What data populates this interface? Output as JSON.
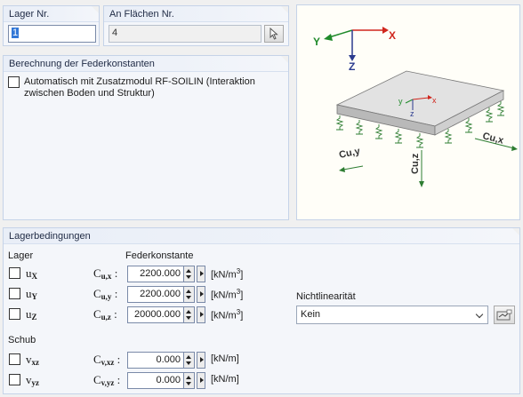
{
  "lager_panel": {
    "title": "Lager Nr.",
    "value": "1"
  },
  "flaechen_panel": {
    "title": "An Flächen Nr.",
    "value": "4"
  },
  "federkonstanten_panel": {
    "title": "Berechnung der Federkonstanten",
    "checkbox_label_line1": "Automatisch mit Zusatzmodul RF-SOILIN (Interaktion",
    "checkbox_label_line2": "zwischen Boden und Struktur)",
    "checked": false
  },
  "diagram": {
    "axis_x": "X",
    "axis_y": "Y",
    "axis_z": "Z",
    "local_x": "x",
    "local_y": "y",
    "local_z": "z",
    "label_cuy": "Cu,y",
    "label_cux": "Cu,x",
    "label_cuz": "Cu,z",
    "colors": {
      "x_axis": "#d0261d",
      "y_axis": "#1f8a2a",
      "z_axis": "#2b3b8f",
      "plate": "#dcdcdc",
      "spring": "#2e7d32"
    }
  },
  "lagerbedingungen": {
    "title": "Lagerbedingungen",
    "lager_heading": "Lager",
    "federkonstante_heading": "Federkonstante",
    "schub_heading": "Schub",
    "rows": [
      {
        "dof": "u",
        "dof_sub": "X",
        "const": "C",
        "const_sub": "u,x",
        "value": "2200.000",
        "unit": "[kN/m",
        "unit_sup": "3",
        "unit_end": "]",
        "checked": false
      },
      {
        "dof": "u",
        "dof_sub": "Y",
        "const": "C",
        "const_sub": "u,y",
        "value": "2200.000",
        "unit": "[kN/m",
        "unit_sup": "3",
        "unit_end": "]",
        "checked": false
      },
      {
        "dof": "u",
        "dof_sub": "Z",
        "const": "C",
        "const_sub": "u,z",
        "value": "20000.000",
        "unit": "[kN/m",
        "unit_sup": "3",
        "unit_end": "]",
        "checked": false
      }
    ],
    "schub_rows": [
      {
        "dof": "v",
        "dof_sub": "xz",
        "const": "C",
        "const_sub": "v,xz",
        "value": "0.000",
        "unit": "[kN/m]",
        "checked": false
      },
      {
        "dof": "v",
        "dof_sub": "yz",
        "const": "C",
        "const_sub": "v,yz",
        "value": "0.000",
        "unit": "[kN/m]",
        "checked": false
      }
    ],
    "nichtlinearitaet_label": "Nichtlinearität",
    "nichtlinearitaet_value": "Kein"
  }
}
